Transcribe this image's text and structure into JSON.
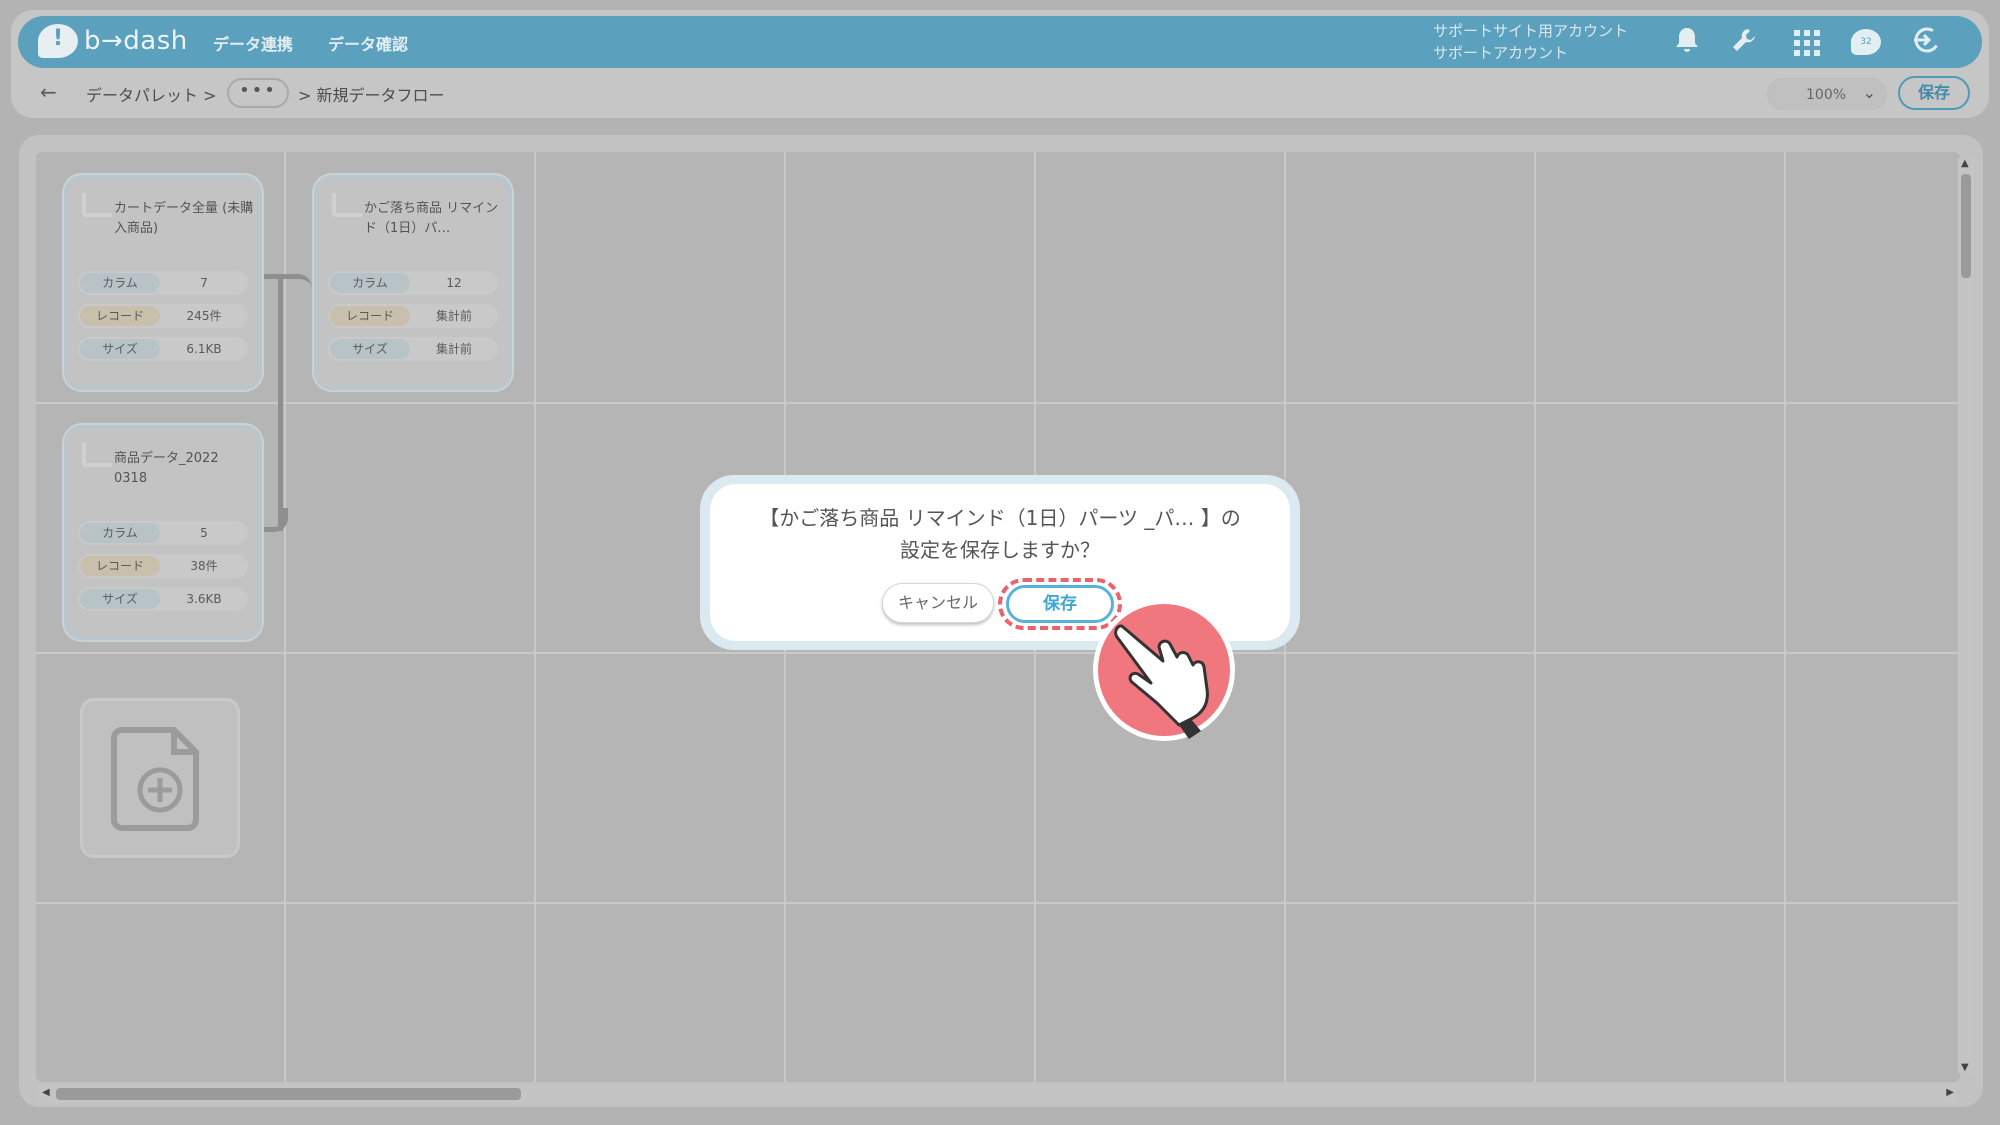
{
  "header": {
    "logo_text": "b→dash",
    "nav": [
      "データ連携",
      "データ確認"
    ],
    "account_line1": "サポートサイト用アカウント",
    "account_line2": "サポートアカウント",
    "chat_badge": "32"
  },
  "breadcrumb": {
    "back": "←",
    "root": "データパレット >",
    "more": "•••",
    "current": "> 新規データフロー"
  },
  "toolbar": {
    "zoom": "100%",
    "save_label": "保存"
  },
  "cards": [
    {
      "title": "カートデータ全量 (未購入商品)",
      "rows": [
        {
          "key": "カラム",
          "value": "7"
        },
        {
          "key": "レコード",
          "value": "245件"
        },
        {
          "key": "サイズ",
          "value": "6.1KB"
        }
      ]
    },
    {
      "title": "かご落ち商品 リマインド（1日）パ…",
      "rows": [
        {
          "key": "カラム",
          "value": "12"
        },
        {
          "key": "レコード",
          "value": "集計前"
        },
        {
          "key": "サイズ",
          "value": "集計前"
        }
      ]
    },
    {
      "title": "商品データ_2022 0318",
      "rows": [
        {
          "key": "カラム",
          "value": "5"
        },
        {
          "key": "レコード",
          "value": "38件"
        },
        {
          "key": "サイズ",
          "value": "3.6KB"
        }
      ]
    }
  ],
  "dialog": {
    "message_line1": "【かご落ち商品 リマインド（1日）パーツ _パ… 】の",
    "message_line2": "設定を保存しますか？",
    "cancel_label": "キャンセル",
    "save_label": "保存"
  },
  "colors": {
    "header_bg": "#5ba0bd",
    "accent": "#55b3d9",
    "highlight": "#e8636a",
    "pointer": "#ef777d"
  }
}
